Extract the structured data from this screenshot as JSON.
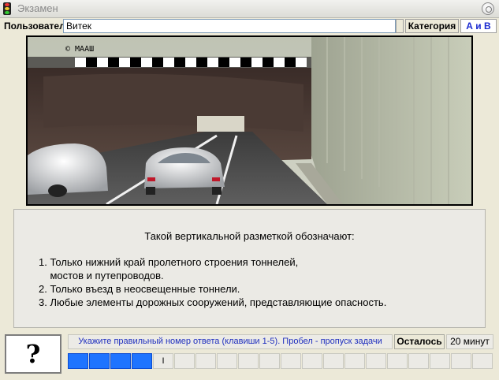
{
  "window": {
    "title": "Экзамен"
  },
  "user": {
    "label": "Пользователь",
    "name": "Витек"
  },
  "category": {
    "label": "Категория",
    "value": "А и В"
  },
  "scene": {
    "watermark": "© МААШ",
    "description_icon": "tunnel-road-image"
  },
  "question": {
    "title": "Такой вертикальной разметкой обозначают:",
    "answers": [
      "1. Только нижний край пролетного строения тоннелей,",
      "    мостов и путепроводов.",
      "2. Только въезд в неосвещенные тоннели.",
      "3. Любые элементы дорожных сооружений, представляющие опасность."
    ]
  },
  "help": {
    "label": "?"
  },
  "hint": "Укажите правильный номер ответа (клавиши 1-5). Пробел - пропуск задачи",
  "remaining": {
    "label": "Осталось",
    "value": "20 минут"
  },
  "progress": {
    "total": 20,
    "done": 4,
    "current_marker": "I",
    "done_color": "#1e74ff"
  }
}
